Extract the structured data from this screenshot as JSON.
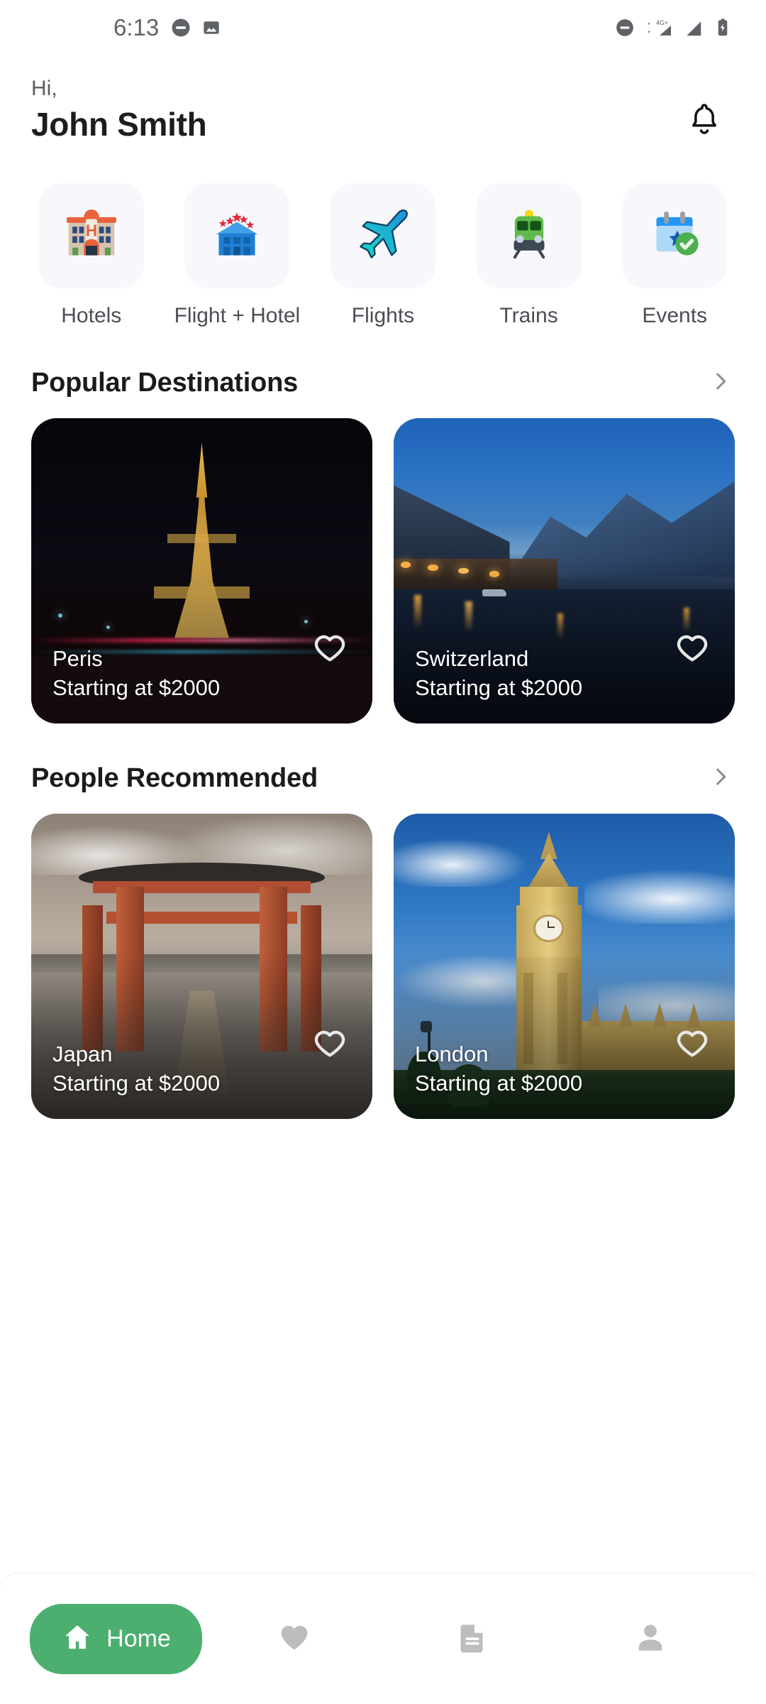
{
  "status_bar": {
    "time": "6:13",
    "left_icons": [
      "do-not-disturb-icon",
      "image-icon"
    ],
    "right_icons": [
      "mute-icon",
      "signal-4g-plus-icon",
      "signal-bars-icon",
      "battery-charging-icon"
    ],
    "network_label": "4G+"
  },
  "header": {
    "greeting": "Hi,",
    "user_name": "John Smith",
    "notification_icon": "bell-icon"
  },
  "categories": [
    {
      "label": "Hotels",
      "icon": "hotel-building-icon"
    },
    {
      "label": "Flight + Hotel",
      "icon": "five-star-hotel-icon"
    },
    {
      "label": "Flights",
      "icon": "airplane-icon"
    },
    {
      "label": "Trains",
      "icon": "train-icon"
    },
    {
      "label": "Events",
      "icon": "calendar-star-check-icon"
    }
  ],
  "sections": [
    {
      "title": "Popular Destinations",
      "arrow_icon": "chevron-right-icon",
      "cards": [
        {
          "city": "Peris",
          "price": "Starting at $2000",
          "favorite_icon": "heart-outline-icon",
          "scene": "eiffel-night"
        },
        {
          "city": "Switzerland",
          "price": "Starting at $2000",
          "favorite_icon": "heart-outline-icon",
          "scene": "lake-mountains-dusk"
        }
      ]
    },
    {
      "title": "People Recommended",
      "arrow_icon": "chevron-right-icon",
      "cards": [
        {
          "city": "Japan",
          "price": "Starting at $2000",
          "favorite_icon": "heart-outline-icon",
          "scene": "torii-gate"
        },
        {
          "city": "London",
          "price": "Starting at $2000",
          "favorite_icon": "heart-outline-icon",
          "scene": "big-ben-day"
        }
      ]
    }
  ],
  "bottom_nav": {
    "items": [
      {
        "label": "Home",
        "icon": "home-icon",
        "active": true
      },
      {
        "label": "",
        "icon": "heart-icon",
        "active": false
      },
      {
        "label": "",
        "icon": "document-icon",
        "active": false
      },
      {
        "label": "",
        "icon": "person-icon",
        "active": false
      }
    ]
  },
  "colors": {
    "accent_green": "#4caf6f",
    "tile_bg": "#f8f8fc",
    "inactive_gray": "#bdbdbd",
    "text_primary": "#1b1b1d",
    "text_secondary": "#5a5d63"
  }
}
